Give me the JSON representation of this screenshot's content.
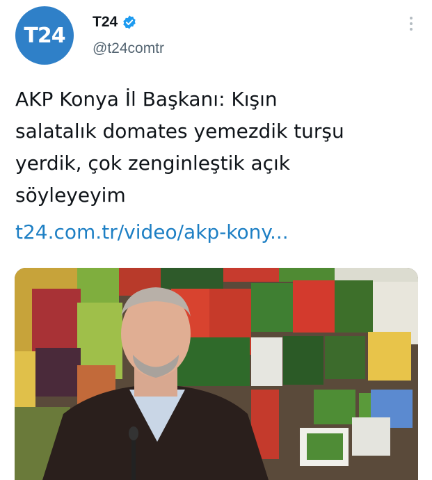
{
  "account": {
    "avatar_text": "T24",
    "display_name": "T24",
    "handle": "@t24comtr",
    "verified": true
  },
  "tweet": {
    "text_lines": [
      "AKP Konya İl Başkanı: Kışın",
      "salatalık domates yemezdik turşu",
      "yerdik, çok zenginleştik açık",
      "söyleyeyim"
    ],
    "link": "t24.com.tr/video/akp-kony..."
  },
  "icons": {
    "verified": "verified-badge-icon",
    "more": "more-options-icon"
  },
  "colors": {
    "avatar_bg": "#2f80c8",
    "verified": "#1d9bf0",
    "link": "#1d7fc4",
    "handle": "#536471"
  }
}
